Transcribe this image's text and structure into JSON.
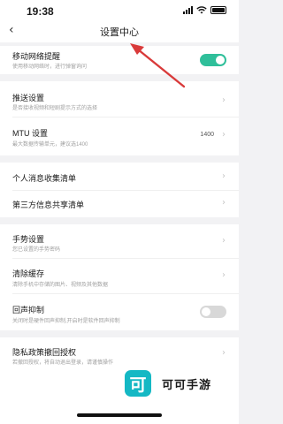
{
  "status_bar": {
    "time": "19:38"
  },
  "header": {
    "back_icon": "chevron-left-icon",
    "title": "设置中心"
  },
  "settings": {
    "mobile_network": {
      "label": "移动网络提醒",
      "desc": "使用移动网络时，进行弹窗询问",
      "enabled": true
    },
    "push": {
      "label": "推送设置",
      "desc": "是否接收视频和短剧提示方式的选择"
    },
    "mtu": {
      "label": "MTU 设置",
      "desc": "最大数据传输单元，建议选1400",
      "value": "1400"
    },
    "personal_info": {
      "label": "个人消息收集清单"
    },
    "third_party": {
      "label": "第三方信息共享清单"
    },
    "gesture": {
      "label": "手势设置",
      "desc": "您已设置的手势密码"
    },
    "clear_cache": {
      "label": "清除缓存",
      "desc": "清除手机中存储的图片、视频及其他数据"
    },
    "echo": {
      "label": "回声抑制",
      "desc": "关闭时是硬件回声抑制,开启时是软件回声抑制",
      "enabled": false
    },
    "privacy": {
      "label": "隐私政策撤回授权",
      "desc": "若撤回授权，将自动退出登录，请谨慎操作"
    }
  },
  "watermark": {
    "logo_char": "可",
    "text": "可可手游"
  },
  "colors": {
    "toggle_on": "#2fbf9a",
    "toggle_off": "#d8d8d8",
    "arrow": "#d93a3a",
    "watermark": "#14b8c4"
  }
}
